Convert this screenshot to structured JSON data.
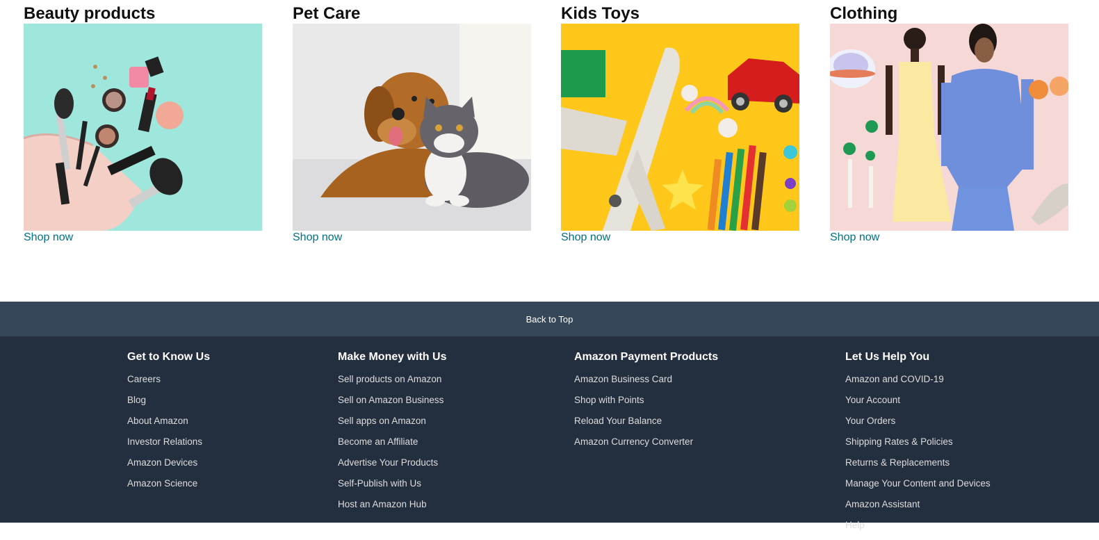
{
  "cards": [
    {
      "title": "Beauty products",
      "link": "Shop now"
    },
    {
      "title": "Pet Care",
      "link": "Shop now"
    },
    {
      "title": "Kids Toys",
      "link": "Shop now"
    },
    {
      "title": "Clothing",
      "link": "Shop now"
    }
  ],
  "back_to_top": "Back to Top",
  "footer": {
    "columns": [
      {
        "heading": "Get to Know Us",
        "links": [
          "Careers",
          "Blog",
          "About Amazon",
          "Investor Relations",
          "Amazon Devices",
          "Amazon Science"
        ]
      },
      {
        "heading": "Make Money with Us",
        "links": [
          "Sell products on Amazon",
          "Sell on Amazon Business",
          "Sell apps on Amazon",
          "Become an Affiliate",
          "Advertise Your Products",
          "Self-Publish with Us",
          "Host an Amazon Hub"
        ]
      },
      {
        "heading": "Amazon Payment Products",
        "links": [
          "Amazon Business Card",
          "Shop with Points",
          "Reload Your Balance",
          "Amazon Currency Converter"
        ]
      },
      {
        "heading": "Let Us Help You",
        "links": [
          "Amazon and COVID-19",
          "Your Account",
          "Your Orders",
          "Shipping Rates & Policies",
          "Returns & Replacements",
          "Manage Your Content and Devices",
          "Amazon Assistant",
          "Help"
        ]
      }
    ]
  },
  "colors": {
    "link": "#007185",
    "footer_bg": "#232f3e",
    "back_to_top_bg": "#37475a"
  }
}
